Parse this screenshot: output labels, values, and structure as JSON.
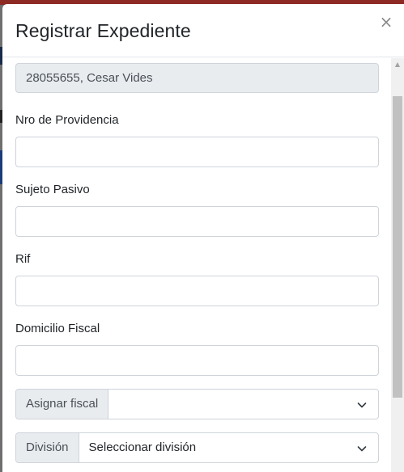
{
  "modal": {
    "title": "Registrar Expediente",
    "close_label": "×"
  },
  "form": {
    "contribuyente_value": "28055655, Cesar Vides",
    "nro_providencia_label": "Nro de Providencia",
    "nro_providencia_value": "",
    "sujeto_pasivo_label": "Sujeto Pasivo",
    "sujeto_pasivo_value": "",
    "rif_label": "Rif",
    "rif_value": "",
    "domicilio_fiscal_label": "Domicilio Fiscal",
    "domicilio_fiscal_value": "",
    "asignar_fiscal_label": "Asignar fiscal",
    "asignar_fiscal_selected": "",
    "division_label": "División",
    "division_selected": "Seleccionar división"
  },
  "icons": {
    "close": "close-icon",
    "chevron": "chevron-down-icon"
  }
}
